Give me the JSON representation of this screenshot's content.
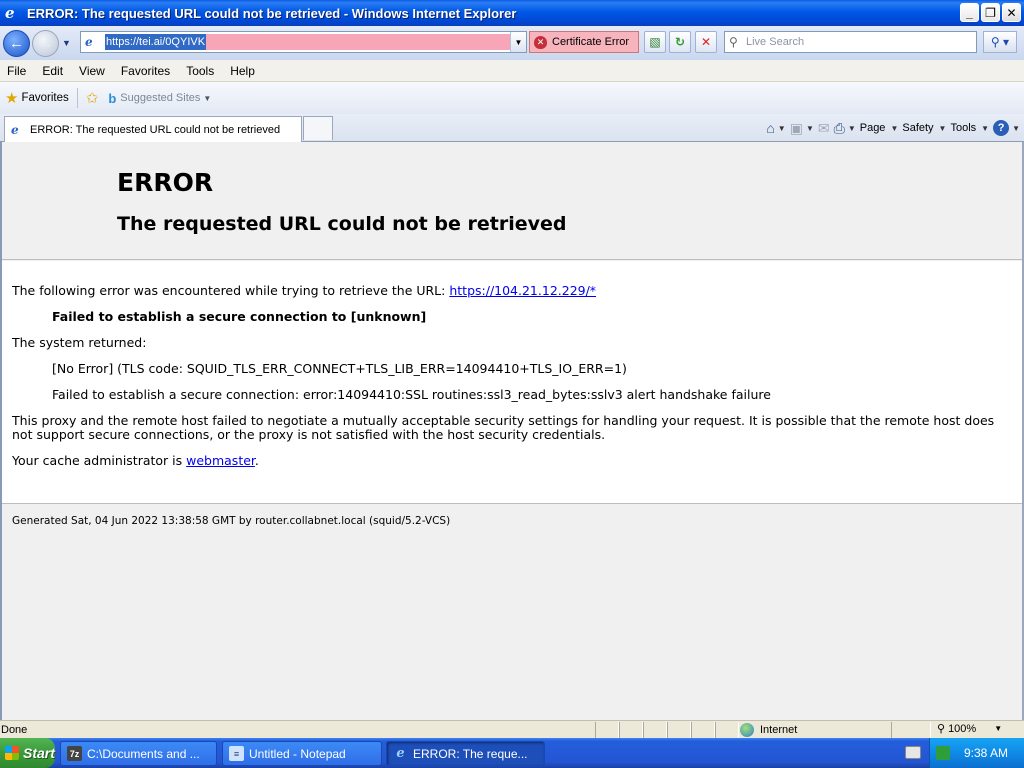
{
  "window": {
    "title": "ERROR: The requested URL could not be retrieved - Windows Internet Explorer"
  },
  "address_bar": {
    "url": "https://tei.ai/0QYIVK",
    "cert_error": "Certificate Error"
  },
  "search": {
    "placeholder": "Live Search"
  },
  "menu": {
    "items": [
      "File",
      "Edit",
      "View",
      "Favorites",
      "Tools",
      "Help"
    ]
  },
  "favorites_bar": {
    "favorites_label": "Favorites",
    "suggested_sites": "Suggested Sites"
  },
  "tab": {
    "title": "ERROR: The requested URL could not be retrieved"
  },
  "command_bar": {
    "page": "Page",
    "safety": "Safety",
    "tools": "Tools"
  },
  "page": {
    "heading": "ERROR",
    "subheading": "The requested URL could not be retrieved",
    "intro": "The following error was encountered while trying to retrieve the URL: ",
    "error_url": "https://104.21.12.229/*",
    "failure": "Failed to establish a secure connection to [unknown]",
    "system_returned": "The system returned:",
    "tls_code": "[No Error] (TLS code: SQUID_TLS_ERR_CONNECT+TLS_LIB_ERR=14094410+TLS_IO_ERR=1)",
    "ssl_detail": "Failed to establish a secure connection: error:14094410:SSL routines:ssl3_read_bytes:sslv3 alert handshake failure",
    "explanation": "This proxy and the remote host failed to negotiate a mutually acceptable security settings for handling your request. It is possible that the remote host does not support secure connections, or the proxy is not satisfied with the host security credentials.",
    "admin_prefix": "Your cache administrator is ",
    "admin_link": "webmaster",
    "admin_suffix": ".",
    "generated": "Generated Sat, 04 Jun 2022 13:38:58 GMT by router.collabnet.local (squid/5.2-VCS)"
  },
  "status_bar": {
    "status": "Done",
    "zone": "Internet",
    "zoom": "100%"
  },
  "taskbar": {
    "start": "Start",
    "items": [
      "C:\\Documents and ...",
      "Untitled - Notepad",
      "ERROR: The reque..."
    ],
    "clock": "9:38 AM"
  }
}
